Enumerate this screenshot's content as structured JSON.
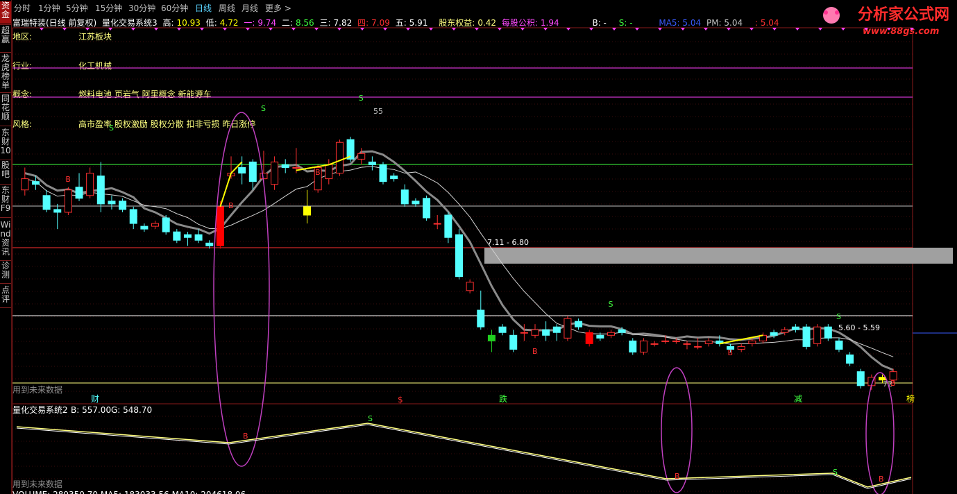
{
  "timeframes": [
    "分时",
    "1分钟",
    "5分钟",
    "15分钟",
    "30分钟",
    "60分钟",
    "日线",
    "周线",
    "月线",
    "更多 >"
  ],
  "active_timeframe": "日线",
  "sidebar": [
    "资金",
    "超赢",
    "龙虎榜单",
    "同花顺",
    "东财10",
    "股吧",
    "东财F9",
    "Wind资讯",
    "诊测",
    "点评"
  ],
  "info": {
    "name": "富瑞特装(日线 前复权)",
    "system": "量化交易系统3",
    "high_label": "高:",
    "high": "10.93",
    "low_label": "低:",
    "low": "4.72",
    "one_label": "一:",
    "one": "9.74",
    "two_label": "二:",
    "two": "8.56",
    "three_label": "三:",
    "three": "7.82",
    "four_label": "四:",
    "four": "7.09",
    "five_label": "五:",
    "five": "5.91",
    "equity_label": "股东权益:",
    "equity": "0.42",
    "nav_label": "每股公积:",
    "nav": "1.94",
    "b_label": "B: -",
    "s_label": "S: -",
    "ma5": "MA5: 5.04",
    "pm": "PM: 5.04",
    "last": ": 5.04"
  },
  "profile": [
    {
      "key": "地区:",
      "value": "江苏板块"
    },
    {
      "key": "行业:",
      "value": "化工机械"
    },
    {
      "key": "概念:",
      "value": "燃料电池 页岩气 阿里概念 新能源车"
    },
    {
      "key": "风格:",
      "value": "高市盈率 股权激励 股权分散 扣非亏损 昨日涨停"
    }
  ],
  "annotations": {
    "zone_label": "7.11 - 6.80",
    "zone2_label": "5.60 - 5.59",
    "peak_label": "55",
    "low_label": "72",
    "future_warning": "用到未来数据",
    "future_warning2": "用到未来数据",
    "bottom_tags": [
      "财",
      "$",
      "跌",
      "减",
      "榜"
    ],
    "lower_title": "量化交易系统2",
    "lower_b": "B: 557.00",
    "lower_g": "G: 548.70",
    "volume_text": "VOLUME: 289350.70  MA5: 183033.56  MA10: 204618.06"
  },
  "logo": {
    "text": "分析家公式网",
    "url": "www.88gs.com"
  },
  "colors": {
    "up": "#ff3030",
    "down": "#54ffff",
    "yellow": "#ffff00",
    "gray": "#909090",
    "ma": "#c8c8c8"
  },
  "chart_data": {
    "type": "candlestick",
    "y_range": [
      4.5,
      11.2
    ],
    "candles": [
      {
        "o": 8.3,
        "h": 8.7,
        "l": 8.2,
        "c": 8.5
      },
      {
        "o": 8.45,
        "h": 8.55,
        "l": 8.3,
        "c": 8.4
      },
      {
        "o": 8.2,
        "h": 8.3,
        "l": 7.9,
        "c": 7.95
      },
      {
        "o": 7.95,
        "h": 8.05,
        "l": 7.6,
        "c": 7.9
      },
      {
        "o": 7.9,
        "h": 8.35,
        "l": 7.85,
        "c": 8.3
      },
      {
        "o": 8.35,
        "h": 8.6,
        "l": 8.1,
        "c": 8.15
      },
      {
        "o": 8.2,
        "h": 8.7,
        "l": 8.15,
        "c": 8.6
      },
      {
        "o": 8.55,
        "h": 8.8,
        "l": 7.9,
        "c": 8.05
      },
      {
        "o": 8.1,
        "h": 8.2,
        "l": 7.95,
        "c": 8.05
      },
      {
        "o": 8.1,
        "h": 8.15,
        "l": 7.9,
        "c": 7.95
      },
      {
        "o": 7.95,
        "h": 8.0,
        "l": 7.6,
        "c": 7.7
      },
      {
        "o": 7.65,
        "h": 7.7,
        "l": 7.55,
        "c": 7.6
      },
      {
        "o": 7.65,
        "h": 7.75,
        "l": 7.6,
        "c": 7.7
      },
      {
        "o": 7.8,
        "h": 7.85,
        "l": 7.5,
        "c": 7.55
      },
      {
        "o": 7.55,
        "h": 7.6,
        "l": 7.35,
        "c": 7.4
      },
      {
        "o": 7.5,
        "h": 7.55,
        "l": 7.3,
        "c": 7.45
      },
      {
        "o": 7.5,
        "h": 7.6,
        "l": 7.35,
        "c": 7.4
      },
      {
        "o": 7.35,
        "h": 7.4,
        "l": 7.25,
        "c": 7.3
      },
      {
        "o": 7.3,
        "h": 8.1,
        "l": 7.25,
        "c": 8.0
      },
      {
        "o": 8.55,
        "h": 8.9,
        "l": 8.5,
        "c": 8.6
      },
      {
        "o": 8.7,
        "h": 8.9,
        "l": 8.4,
        "c": 8.6
      },
      {
        "o": 8.8,
        "h": 8.85,
        "l": 8.3,
        "c": 8.45
      },
      {
        "o": 8.5,
        "h": 9.0,
        "l": 8.45,
        "c": 8.6
      },
      {
        "o": 8.4,
        "h": 8.9,
        "l": 8.3,
        "c": 8.8
      },
      {
        "o": 8.75,
        "h": 8.85,
        "l": 8.6,
        "c": 8.7
      },
      {
        "o": 8.7,
        "h": 9.05,
        "l": 8.6,
        "c": 8.7
      },
      {
        "o": 8.0,
        "h": 8.3,
        "l": 7.7,
        "c": 7.85
      },
      {
        "o": 8.3,
        "h": 8.75,
        "l": 8.25,
        "c": 8.7
      },
      {
        "o": 8.5,
        "h": 8.85,
        "l": 8.4,
        "c": 8.75
      },
      {
        "o": 8.6,
        "h": 9.2,
        "l": 8.55,
        "c": 9.15
      },
      {
        "o": 9.2,
        "h": 9.25,
        "l": 8.8,
        "c": 8.85
      },
      {
        "o": 8.85,
        "h": 9.05,
        "l": 8.75,
        "c": 8.95
      },
      {
        "o": 8.8,
        "h": 8.9,
        "l": 8.65,
        "c": 8.75
      },
      {
        "o": 8.75,
        "h": 8.8,
        "l": 8.4,
        "c": 8.45
      },
      {
        "o": 8.55,
        "h": 8.6,
        "l": 8.45,
        "c": 8.5
      },
      {
        "o": 8.3,
        "h": 8.4,
        "l": 8.0,
        "c": 8.05
      },
      {
        "o": 8.1,
        "h": 8.15,
        "l": 8.0,
        "c": 8.05
      },
      {
        "o": 8.15,
        "h": 8.2,
        "l": 7.75,
        "c": 7.8
      },
      {
        "o": 7.7,
        "h": 7.85,
        "l": 7.6,
        "c": 7.7
      },
      {
        "o": 7.85,
        "h": 7.9,
        "l": 7.35,
        "c": 7.45
      },
      {
        "o": 7.5,
        "h": 7.6,
        "l": 6.7,
        "c": 6.75
      },
      {
        "o": 6.5,
        "h": 6.7,
        "l": 6.45,
        "c": 6.65
      },
      {
        "o": 6.15,
        "h": 6.5,
        "l": 5.8,
        "c": 5.85
      },
      {
        "o": 5.6,
        "h": 5.8,
        "l": 5.4,
        "c": 5.7
      },
      {
        "o": 5.85,
        "h": 5.9,
        "l": 5.7,
        "c": 5.75
      },
      {
        "o": 5.7,
        "h": 5.8,
        "l": 5.4,
        "c": 5.45
      },
      {
        "o": 5.75,
        "h": 5.9,
        "l": 5.6,
        "c": 5.75
      },
      {
        "o": 5.7,
        "h": 5.9,
        "l": 5.65,
        "c": 5.8
      },
      {
        "o": 5.8,
        "h": 5.95,
        "l": 5.6,
        "c": 5.7
      },
      {
        "o": 5.85,
        "h": 5.9,
        "l": 5.6,
        "c": 5.75
      },
      {
        "o": 5.65,
        "h": 6.05,
        "l": 5.6,
        "c": 6.0
      },
      {
        "o": 5.95,
        "h": 6.0,
        "l": 5.8,
        "c": 5.85
      },
      {
        "o": 5.75,
        "h": 5.8,
        "l": 5.5,
        "c": 5.55
      },
      {
        "o": 5.7,
        "h": 5.75,
        "l": 5.6,
        "c": 5.65
      },
      {
        "o": 5.7,
        "h": 5.8,
        "l": 5.65,
        "c": 5.75
      },
      {
        "o": 5.8,
        "h": 5.85,
        "l": 5.7,
        "c": 5.75
      },
      {
        "o": 5.6,
        "h": 5.65,
        "l": 5.35,
        "c": 5.4
      },
      {
        "o": 5.4,
        "h": 5.65,
        "l": 5.35,
        "c": 5.6
      },
      {
        "o": 5.55,
        "h": 5.6,
        "l": 5.5,
        "c": 5.55
      },
      {
        "o": 5.6,
        "h": 5.7,
        "l": 5.55,
        "c": 5.6
      },
      {
        "o": 5.6,
        "h": 5.65,
        "l": 5.55,
        "c": 5.6
      },
      {
        "o": 5.55,
        "h": 5.6,
        "l": 5.45,
        "c": 5.55
      },
      {
        "o": 5.5,
        "h": 5.65,
        "l": 5.45,
        "c": 5.5
      },
      {
        "o": 5.55,
        "h": 5.65,
        "l": 5.5,
        "c": 5.6
      },
      {
        "o": 5.6,
        "h": 5.7,
        "l": 5.5,
        "c": 5.55
      },
      {
        "o": 5.5,
        "h": 5.55,
        "l": 5.4,
        "c": 5.45
      },
      {
        "o": 5.45,
        "h": 5.55,
        "l": 5.4,
        "c": 5.5
      },
      {
        "o": 5.55,
        "h": 5.65,
        "l": 5.5,
        "c": 5.6
      },
      {
        "o": 5.6,
        "h": 5.75,
        "l": 5.55,
        "c": 5.7
      },
      {
        "o": 5.75,
        "h": 5.8,
        "l": 5.65,
        "c": 5.7
      },
      {
        "o": 5.75,
        "h": 5.85,
        "l": 5.7,
        "c": 5.8
      },
      {
        "o": 5.85,
        "h": 5.9,
        "l": 5.75,
        "c": 5.8
      },
      {
        "o": 5.85,
        "h": 5.9,
        "l": 5.45,
        "c": 5.5
      },
      {
        "o": 5.55,
        "h": 5.9,
        "l": 5.5,
        "c": 5.85
      },
      {
        "o": 5.85,
        "h": 5.9,
        "l": 5.6,
        "c": 5.65
      },
      {
        "o": 5.6,
        "h": 5.65,
        "l": 5.4,
        "c": 5.45
      },
      {
        "o": 5.35,
        "h": 5.4,
        "l": 5.15,
        "c": 5.2
      },
      {
        "o": 5.05,
        "h": 5.1,
        "l": 4.75,
        "c": 4.8
      },
      {
        "o": 4.8,
        "h": 5.0,
        "l": 4.72,
        "c": 4.95
      },
      {
        "o": 4.95,
        "h": 5.0,
        "l": 4.85,
        "c": 4.9
      },
      {
        "o": 4.9,
        "h": 5.1,
        "l": 4.85,
        "c": 5.05
      }
    ]
  }
}
